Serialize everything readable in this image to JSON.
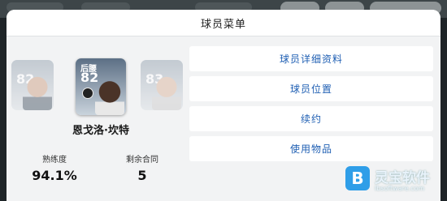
{
  "modal": {
    "title": "球员菜单"
  },
  "player": {
    "name": "恩戈洛·坎特",
    "position": "后腰",
    "rating": "82"
  },
  "side_cards": {
    "left": {
      "rating": "82"
    },
    "right": {
      "rating": "83"
    }
  },
  "stats": {
    "proficiency_label": "熟练度",
    "proficiency_value": "94.1%",
    "contract_label": "剩余合同",
    "contract_value": "5"
  },
  "menu": {
    "items": [
      {
        "label": "球员详细资料"
      },
      {
        "label": "球员位置"
      },
      {
        "label": "续约"
      },
      {
        "label": "使用物品"
      }
    ]
  },
  "watermark": {
    "logo_glyph": "B",
    "name": "灵宝软件",
    "url": "lbsoftware.com"
  }
}
